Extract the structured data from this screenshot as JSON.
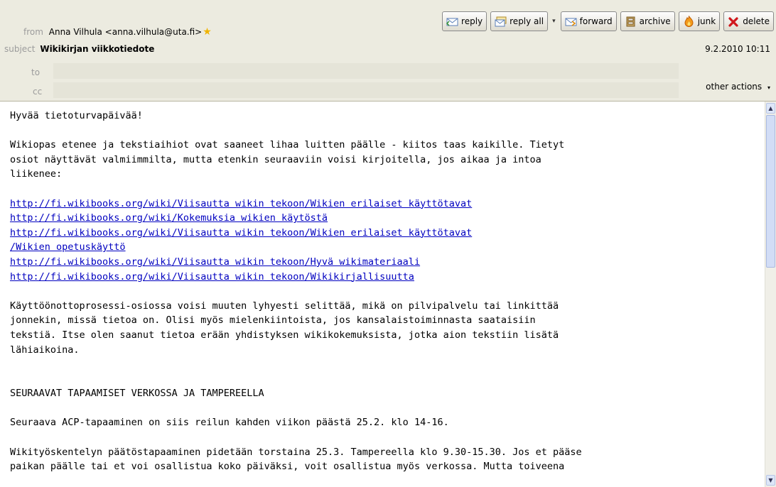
{
  "header": {
    "from_label": "from",
    "from_value": "Anna Vilhula <anna.vilhula@uta.fi>",
    "subject_label": "subject",
    "subject_value": "Wikikirjan viikkotiedote",
    "to_label": "to",
    "cc_label": "cc",
    "date": "9.2.2010 10:11",
    "other_actions": "other actions"
  },
  "toolbar": {
    "reply": "reply",
    "reply_all": "reply all",
    "forward": "forward",
    "archive": "archive",
    "junk": "junk",
    "delete": "delete"
  },
  "message": {
    "greeting": "Hyvää tietoturvapäivää!",
    "intro": [
      "Wikiopas etenee ja tekstiaihiot ovat saaneet lihaa luitten päälle - kiitos taas kaikille. Tietyt",
      "osiot näyttävät valmiimmilta, mutta etenkin seuraaviin voisi kirjoitella, jos aikaa ja intoa",
      "liikenee:"
    ],
    "links": [
      "http://fi.wikibooks.org/wiki/Viisautta wikin tekoon/Wikien erilaiset käyttötavat",
      "http://fi.wikibooks.org/wiki/Kokemuksia wikien käytöstä",
      "http://fi.wikibooks.org/wiki/Viisautta wikin tekoon/Wikien erilaiset käyttötavat",
      "/Wikien opetuskäyttö",
      "http://fi.wikibooks.org/wiki/Viisautta wikin tekoon/Hyvä wikimateriaali",
      "http://fi.wikibooks.org/wiki/Viisautta wikin tekoon/Wikikirjallisuutta"
    ],
    "para2": [
      "Käyttöönottoprosessi-osiossa voisi muuten lyhyesti selittää, mikä on pilvipalvelu tai linkittää",
      "jonnekin, missä tietoa on. Olisi myös mielenkiintoista, jos kansalaistoiminnasta saataisiin",
      "tekstiä. Itse olen saanut tietoa erään yhdistyksen wikikokemuksista, jotka aion tekstiin lisätä",
      "lähiaikoina."
    ],
    "section_heading": "SEURAAVAT TAPAAMISET VERKOSSA JA TAMPEREELLA",
    "para3": "Seuraava ACP-tapaaminen on siis reilun kahden viikon päästä 25.2. klo 14-16.",
    "para4": [
      "Wikityöskentelyn päätöstapaaminen pidetään torstaina 25.3. Tampereella klo 9.30-15.30. Jos et pääse",
      "paikan päälle tai et voi osallistua koko päiväksi, voit osallistua myös verkossa. Mutta toiveena"
    ]
  },
  "icons": {
    "reply": "reply-icon",
    "reply_all": "reply-all-icon",
    "forward": "forward-icon",
    "archive": "archive-icon",
    "junk": "junk-icon",
    "delete": "delete-icon",
    "star": "star-icon"
  }
}
